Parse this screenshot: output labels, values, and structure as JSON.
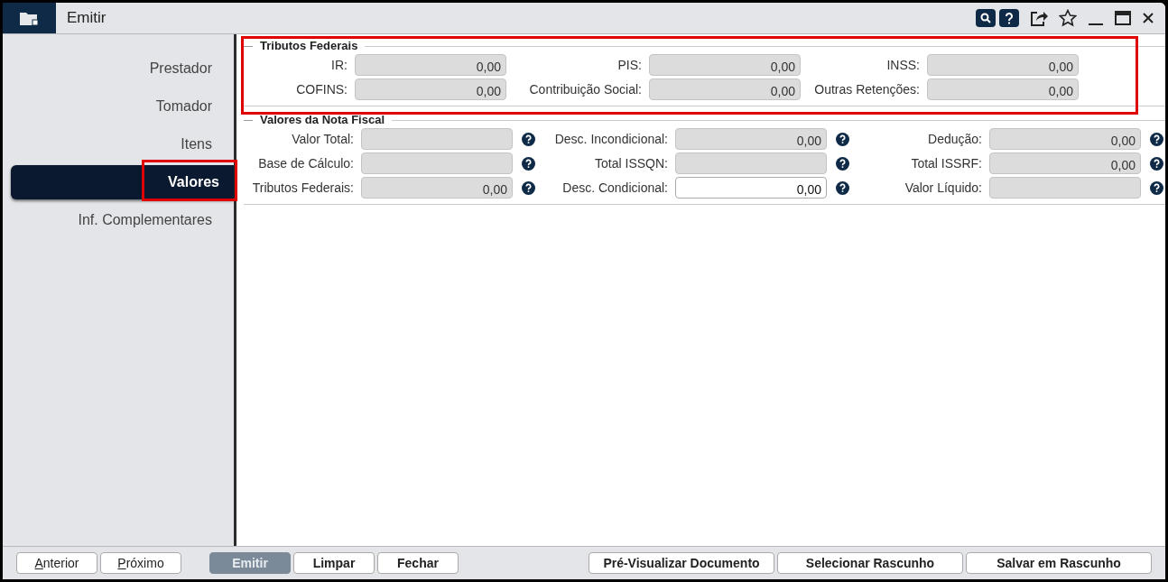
{
  "window": {
    "title": "Emitir"
  },
  "sidebar": {
    "items": [
      {
        "label": "Prestador",
        "selected": false
      },
      {
        "label": "Tomador",
        "selected": false
      },
      {
        "label": "Itens",
        "selected": false
      },
      {
        "label": "Valores",
        "selected": true
      },
      {
        "label": "Inf. Complementares",
        "selected": false
      }
    ]
  },
  "sections": [
    {
      "title": "Tributos Federais",
      "highlighted": true,
      "help": false,
      "fields": [
        {
          "label": "IR:",
          "value": "0,00",
          "disabled": true
        },
        {
          "label": "PIS:",
          "value": "0,00",
          "disabled": true
        },
        {
          "label": "INSS:",
          "value": "0,00",
          "disabled": true
        },
        {
          "label": "COFINS:",
          "value": "0,00",
          "disabled": true
        },
        {
          "label": "Contribuição Social:",
          "value": "0,00",
          "disabled": true
        },
        {
          "label": "Outras Retenções:",
          "value": "0,00",
          "disabled": true
        }
      ]
    },
    {
      "title": "Valores da Nota Fiscal",
      "highlighted": false,
      "help": true,
      "fields": [
        {
          "label": "Valor Total:",
          "disabled": true
        },
        {
          "label": "Desc. Incondicional:",
          "value": "0,00",
          "disabled": true
        },
        {
          "label": "Dedução:",
          "value": "0,00",
          "disabled": true
        },
        {
          "label": "Base de Cálculo:",
          "disabled": true
        },
        {
          "label": "Total ISSQN:",
          "disabled": true
        },
        {
          "label": "Total ISSRF:",
          "value": "0,00",
          "disabled": true
        },
        {
          "label": "Tributos Federais:",
          "value": "0,00",
          "disabled": true
        },
        {
          "label": "Desc. Condicional:",
          "value": "0,00",
          "disabled": false
        },
        {
          "label": "Valor Líquido:",
          "disabled": true
        }
      ]
    }
  ],
  "footer": {
    "navigation": [
      {
        "label": "Anterior"
      },
      {
        "label": "Próximo"
      }
    ],
    "actions": [
      {
        "label": "Emitir",
        "primary": true
      },
      {
        "label": "Limpar",
        "primary": false
      },
      {
        "label": "Fechar",
        "primary": false
      }
    ],
    "document": [
      {
        "label": "Pré-Visualizar Documento"
      },
      {
        "label": "Selecionar Rascunho"
      },
      {
        "label": "Salvar em Rascunho"
      }
    ]
  }
}
